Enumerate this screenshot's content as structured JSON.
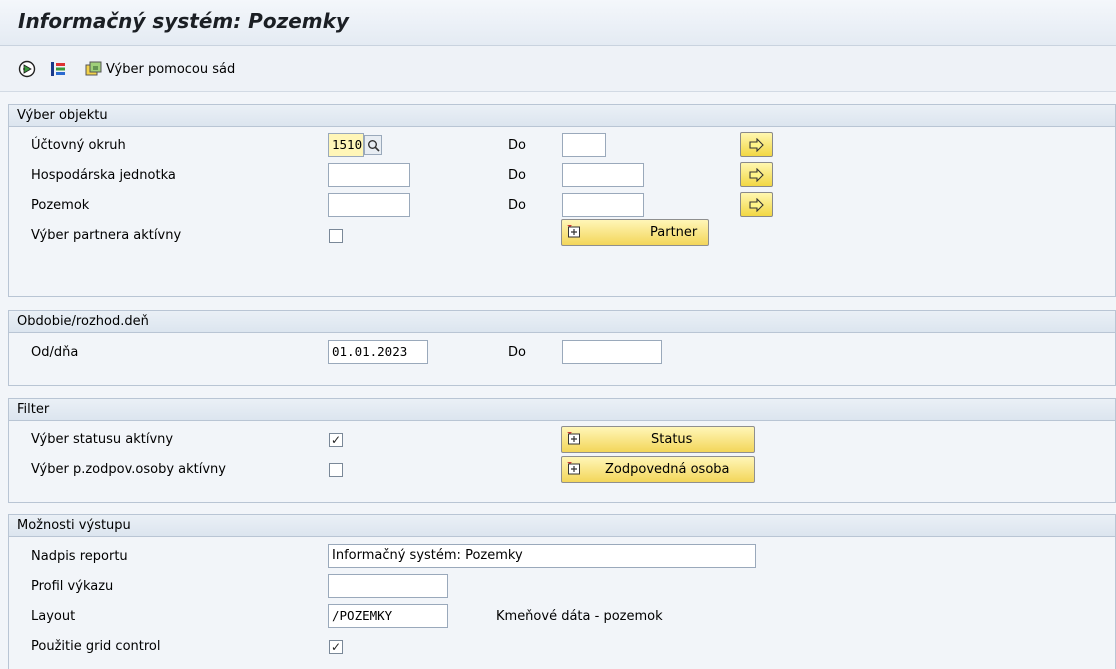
{
  "title": "Informačný systém: Pozemky",
  "toolbar": {
    "select_by_sets": "Výber pomocou sád",
    "icons": [
      "execute-icon",
      "get-variant-icon",
      "selection-sets-icon"
    ]
  },
  "object_selection": {
    "header": "Výber objektu",
    "to_label": "Do",
    "company_code": {
      "label": "Účtovný okruh",
      "value": "1510",
      "to_value": ""
    },
    "business_entity": {
      "label": "Hospodárska jednotka",
      "value": "",
      "to_value": ""
    },
    "land": {
      "label": "Pozemok",
      "value": "",
      "to_value": ""
    },
    "partner_active": {
      "label": "Výber partnera aktívny",
      "checked": false
    },
    "partner_button": "Partner"
  },
  "period": {
    "header": "Obdobie/rozhod.deň",
    "from_label": "Od/dňa",
    "from_value": "01.01.2023",
    "to_label": "Do",
    "to_value": ""
  },
  "filter": {
    "header": "Filter",
    "status_active": {
      "label": "Výber statusu aktívny",
      "checked": true
    },
    "responsible_active": {
      "label": "Výber p.zodpov.osoby aktívny",
      "checked": false
    },
    "status_button": "Status",
    "responsible_button": "Zodpovedná osoba"
  },
  "output": {
    "header": "Možnosti výstupu",
    "report_title": {
      "label": "Nadpis reportu",
      "value": "Informačný systém: Pozemky"
    },
    "report_profile": {
      "label": "Profil výkazu",
      "value": ""
    },
    "layout": {
      "label": "Layout",
      "value": "/POZEMKY",
      "description": "Kmeňové dáta - pozemok"
    },
    "grid_control": {
      "label": "Použitie grid control",
      "checked": true
    }
  },
  "colors": {
    "button_yellow": "#f3d65a",
    "group_border": "#b9c5d4",
    "background": "#f2f5f9"
  }
}
